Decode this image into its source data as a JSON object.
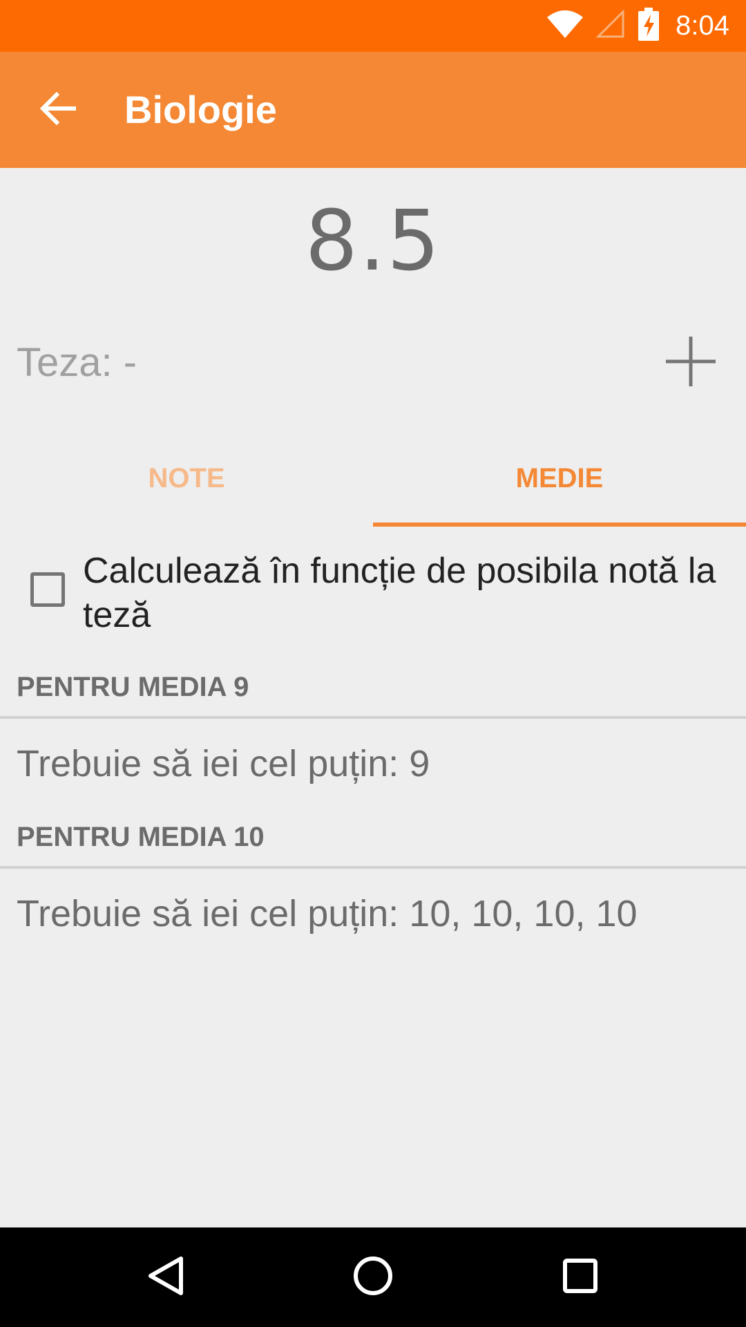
{
  "status_bar": {
    "time": "8:04",
    "icons": [
      "wifi-icon",
      "cellular-signal-icon",
      "battery-charging-icon"
    ],
    "color": "#fd6a02"
  },
  "app_bar": {
    "title": "Biologie",
    "back_icon": "arrow-left-icon",
    "color": "#f48834"
  },
  "average": {
    "value": "8.5"
  },
  "teza": {
    "label": "Teza: -",
    "add_icon": "plus-icon"
  },
  "tabs": [
    {
      "label": "NOTE",
      "selected": false
    },
    {
      "label": "MEDIE",
      "selected": true
    }
  ],
  "checkbox": {
    "label": "Calculează în funcție de posibila notă la teză",
    "checked": false
  },
  "sections": [
    {
      "header": "PENTRU MEDIA 9",
      "text": "Trebuie să iei cel puțin: 9"
    },
    {
      "header": "PENTRU MEDIA 10",
      "text": "Trebuie să iei cel puțin: 10, 10, 10, 10"
    }
  ],
  "nav_bar": {
    "icons": [
      "back-triangle-icon",
      "home-circle-icon",
      "recents-square-icon"
    ]
  }
}
